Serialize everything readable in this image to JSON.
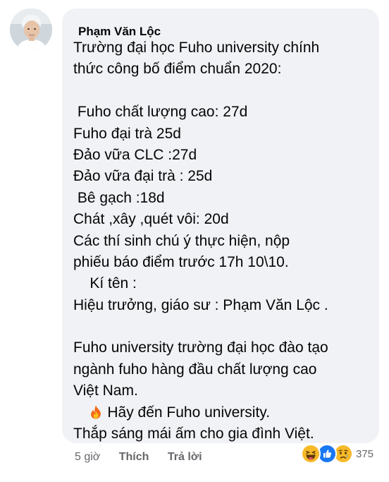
{
  "comment": {
    "author": "Phạm Văn Lộc",
    "lines": [
      "Trường đại học Fuho university chính",
      "thức công bố điểm chuẩn 2020:",
      "",
      " Fuho chất lượng cao: 27d",
      "Fuho đại trà 25d",
      "Đảo vữa CLC :27d",
      "Đảo vữa đại trà : 25d",
      " Bê gạch :18d",
      "Chát ,xây ,quét vôi: 20d",
      "Các thí sinh chú ý thực hiện, nộp",
      "phiếu báo điểm trước 17h 10\\10.",
      "    Kí tên :",
      "Hiệu trưởng, giáo sư : Phạm Văn Lộc .",
      "",
      "Fuho university trường đại học đào tạo",
      "ngành fuho hàng đầu chất lượng cao",
      "Việt Nam."
    ],
    "fire_line": "Hãy đến Fuho university.",
    "last_line": "Thắp sáng mái ấm cho gia đình Việt."
  },
  "actions": {
    "time": "5 giờ",
    "like_label": "Thích",
    "reply_label": "Trả lời"
  },
  "reactions": {
    "icons": [
      "haha-icon",
      "like-icon",
      "sad-icon"
    ],
    "count": "375"
  },
  "colors": {
    "bubble_bg": "#f0f2f5",
    "text": "#050505",
    "secondary": "#65676b",
    "like_blue": "#1877f2",
    "emoji_yellow": "#f7b928"
  }
}
